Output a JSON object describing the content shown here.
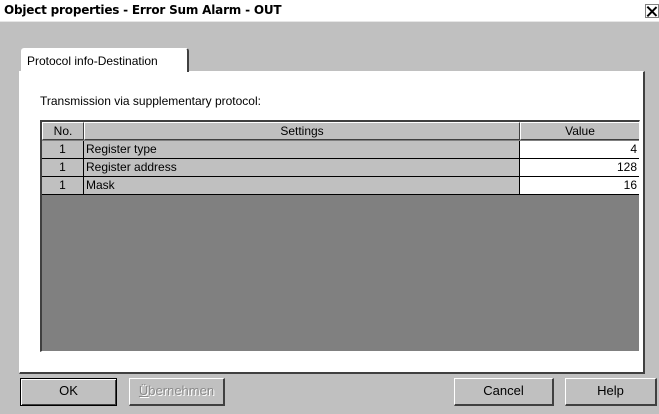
{
  "window": {
    "title": "Object properties - Error Sum Alarm - OUT"
  },
  "tab": {
    "label": "Protocol info-Destination"
  },
  "caption": "Transmission via supplementary protocol:",
  "table": {
    "columns": [
      "No.",
      "Settings",
      "Value"
    ],
    "rows": [
      {
        "no": "1",
        "setting": "Register type",
        "value": "4"
      },
      {
        "no": "1",
        "setting": "Register address",
        "value": "128"
      },
      {
        "no": "1",
        "setting": "Mask",
        "value": "16"
      }
    ]
  },
  "buttons": {
    "ok": "OK",
    "apply_first": "Ü",
    "apply_rest": "bernehmen",
    "cancel": "Cancel",
    "help": "Help"
  },
  "icons": {
    "close": "close-icon"
  },
  "colors": {
    "dialog_face": "#c0c0c0",
    "grid_empty": "#808080",
    "value_cell": "#ffffff",
    "disabled_text": "#8a8a8a"
  }
}
